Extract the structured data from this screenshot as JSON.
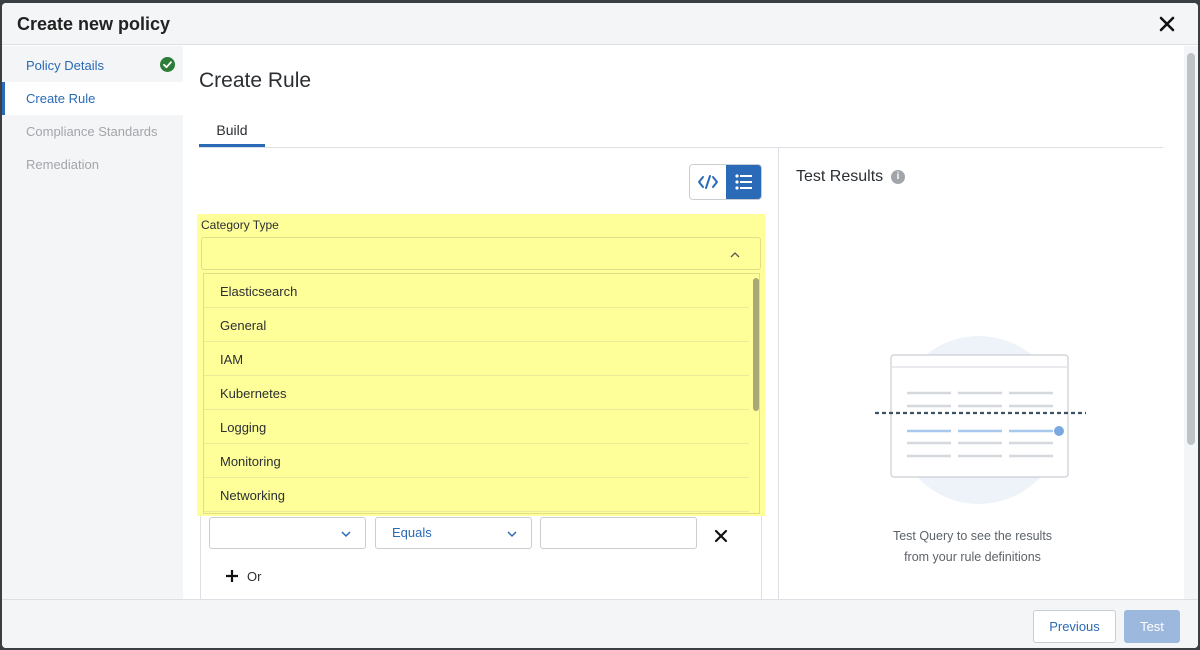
{
  "modal": {
    "title": "Create new policy"
  },
  "sidebar": {
    "items": [
      {
        "label": "Policy Details",
        "state": "done"
      },
      {
        "label": "Create Rule",
        "state": "active"
      },
      {
        "label": "Compliance Standards",
        "state": "disabled"
      },
      {
        "label": "Remediation",
        "state": "disabled"
      }
    ]
  },
  "main": {
    "title": "Create Rule",
    "tab": "Build",
    "view_toggle": [
      "code-icon",
      "list-icon"
    ]
  },
  "category": {
    "label": "Category Type",
    "value": "",
    "options": [
      "Elasticsearch",
      "General",
      "IAM",
      "Kubernetes",
      "Logging",
      "Monitoring",
      "Networking"
    ]
  },
  "rule": {
    "field_value": "",
    "operator": "Equals",
    "value": "",
    "or_label": "Or"
  },
  "results": {
    "title": "Test Results",
    "info_icon": "i",
    "message_line1": "Test Query to see the results",
    "message_line2": "from your rule definitions"
  },
  "footer": {
    "previous_label": "Previous",
    "test_label": "Test"
  },
  "colors": {
    "accent": "#2a6ab6",
    "highlight": "#ffff99",
    "success": "#2d7d3a",
    "disabled_button": "#9db8dd"
  }
}
